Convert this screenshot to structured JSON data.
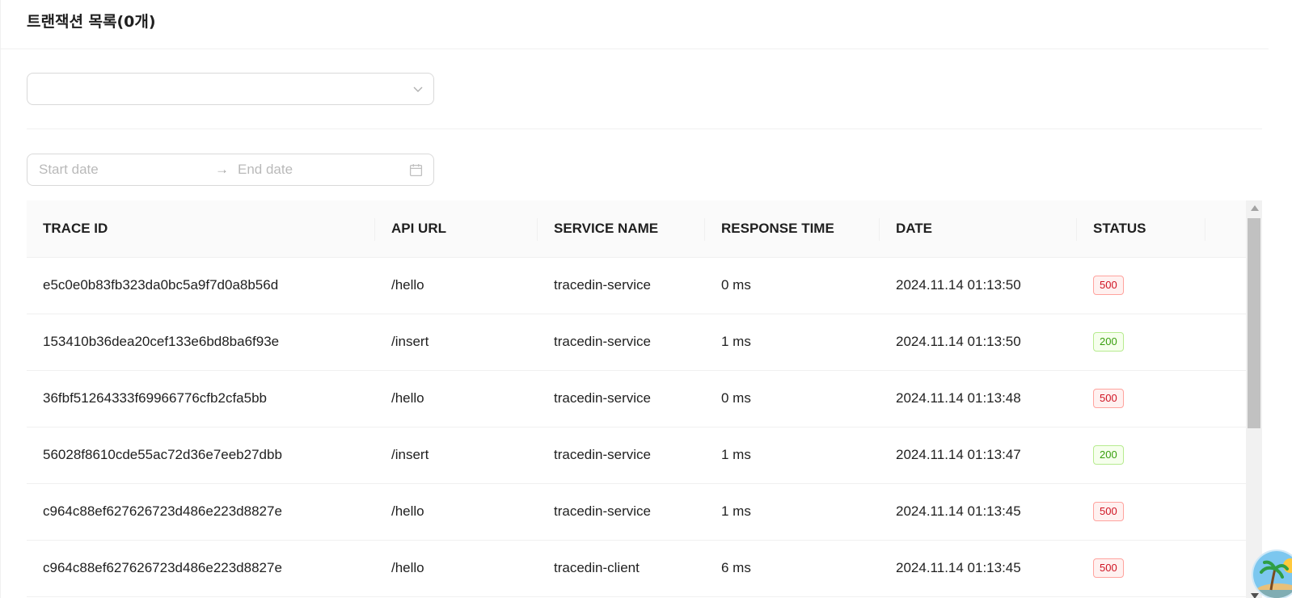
{
  "card": {
    "title": "트랜잭션 목록(0개)"
  },
  "filters": {
    "select_value": "",
    "date_range": {
      "start_placeholder": "Start date",
      "end_placeholder": "End date",
      "separator": "→"
    }
  },
  "table": {
    "columns": [
      "TRACE ID",
      "API URL",
      "SERVICE NAME",
      "RESPONSE TIME",
      "DATE",
      "STATUS"
    ],
    "rows": [
      {
        "trace_id": "e5c0e0b83fb323da0bc5a9f7d0a8b56d",
        "api_url": "/hello",
        "service_name": "tracedin-service",
        "response_time": "0 ms",
        "date": "2024.11.14 01:13:50",
        "status": "500"
      },
      {
        "trace_id": "153410b36dea20cef133e6bd8ba6f93e",
        "api_url": "/insert",
        "service_name": "tracedin-service",
        "response_time": "1 ms",
        "date": "2024.11.14 01:13:50",
        "status": "200"
      },
      {
        "trace_id": "36fbf51264333f69966776cfb2cfa5bb",
        "api_url": "/hello",
        "service_name": "tracedin-service",
        "response_time": "0 ms",
        "date": "2024.11.14 01:13:48",
        "status": "500"
      },
      {
        "trace_id": "56028f8610cde55ac72d36e7eeb27dbb",
        "api_url": "/insert",
        "service_name": "tracedin-service",
        "response_time": "1 ms",
        "date": "2024.11.14 01:13:47",
        "status": "200"
      },
      {
        "trace_id": "c964c88ef627626723d486e223d8827e",
        "api_url": "/hello",
        "service_name": "tracedin-service",
        "response_time": "1 ms",
        "date": "2024.11.14 01:13:45",
        "status": "500"
      },
      {
        "trace_id": "c964c88ef627626723d486e223d8827e",
        "api_url": "/hello",
        "service_name": "tracedin-client",
        "response_time": "6 ms",
        "date": "2024.11.14 01:13:45",
        "status": "500"
      }
    ]
  },
  "colors": {
    "error": "#cf1322",
    "success": "#389e0d",
    "header_bg": "#fafafa",
    "border": "#f0f0f0"
  },
  "icons": {
    "select_arrow": "chevron-down-icon",
    "date_picker": "calendar-icon",
    "floating_button": "island-avatar-icon"
  }
}
